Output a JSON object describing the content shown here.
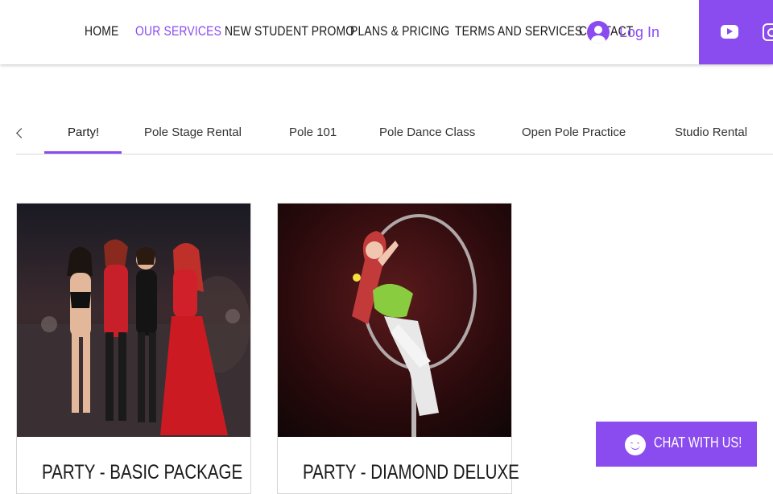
{
  "nav": {
    "items": [
      {
        "label": "HOME"
      },
      {
        "label": "OUR SERVICES",
        "active": true
      },
      {
        "label": "NEW STUDENT PROMO"
      },
      {
        "label": "PLANS & PRICING"
      },
      {
        "label": "TERMS AND SERVICES"
      },
      {
        "label": "CONTACT"
      }
    ]
  },
  "login": {
    "label": "Log In"
  },
  "social": {
    "icons": [
      "youtube-icon",
      "instagram-icon"
    ]
  },
  "tabs": {
    "items": [
      {
        "label": "Party!",
        "active": true
      },
      {
        "label": "Pole Stage Rental"
      },
      {
        "label": "Pole 101"
      },
      {
        "label": "Pole Dance Class"
      },
      {
        "label": "Open Pole Practice"
      },
      {
        "label": "Studio Rental"
      }
    ]
  },
  "cards": [
    {
      "title": "PARTY - BASIC PACKAGE",
      "image": "group-photo-dancers"
    },
    {
      "title": "PARTY - DIAMOND DELUXE",
      "image": "aerial-hoop-performer"
    }
  ],
  "chat": {
    "label": "CHAT WITH US!"
  },
  "colors": {
    "accent": "#8a4bef",
    "text": "#1a1a1a",
    "divider": "#d9d9d9"
  }
}
